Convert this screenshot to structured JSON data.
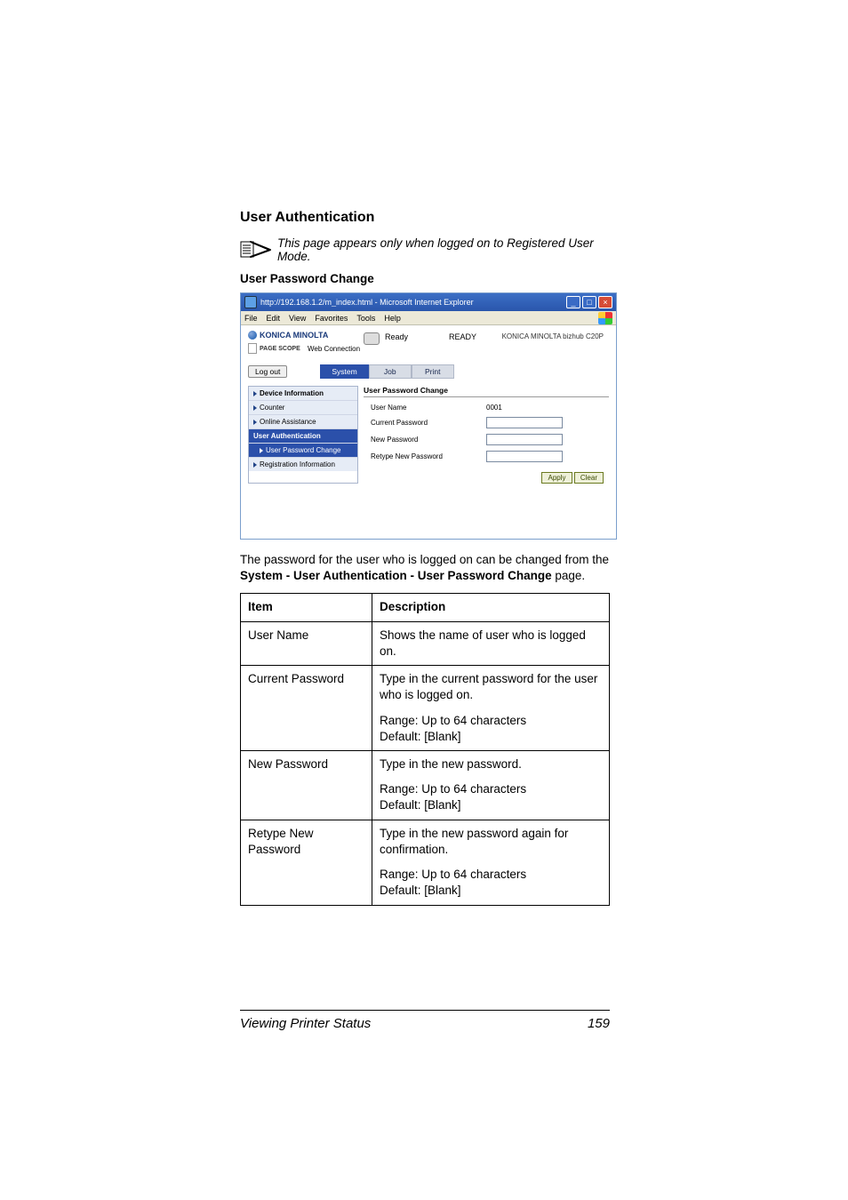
{
  "headings": {
    "h2": "User Authentication",
    "note": "This page appears only when logged on to Registered User Mode.",
    "h3": "User Password Change"
  },
  "screenshot": {
    "title": "http://192.168.1.2/m_index.html - Microsoft Internet Explorer",
    "menu": {
      "file": "File",
      "edit": "Edit",
      "view": "View",
      "fav": "Favorites",
      "tools": "Tools",
      "help": "Help"
    },
    "brand": "KONICA MINOLTA",
    "subbrand1": "PAGE SCOPE",
    "subbrand2": "Web Connection",
    "ready_label": "Ready",
    "ready_status": "READY",
    "model": "KONICA MINOLTA bizhub C20P",
    "logout": "Log out",
    "tabs": {
      "system": "System",
      "job": "Job",
      "print": "Print"
    },
    "side": {
      "devinfo": "Device Information",
      "counter": "Counter",
      "online": "Online Assistance",
      "userauth": "User Authentication",
      "upc": "User Password Change",
      "reg": "Registration Information"
    },
    "main_title": "User Password Change",
    "labels": {
      "uname": "User Name",
      "uval": "0001",
      "cur": "Current Password",
      "newp": "New Password",
      "retype": "Retype New Password"
    },
    "buttons": {
      "apply": "Apply",
      "clear": "Clear"
    }
  },
  "para": {
    "p1a": "The password for the user who is logged on can be changed from the ",
    "p1b": "System - User Authentication - User Password Change",
    "p1c": " page."
  },
  "table": {
    "h_item": "Item",
    "h_desc": "Description",
    "r1_item": "User Name",
    "r1_desc": "Shows the name of user who is logged on.",
    "r2_item": "Current Password",
    "r2_d1": "Type in the current password for the user who is logged on.",
    "r2_d2": "Range:   Up to 64 characters",
    "r2_d3": "Default:  [Blank]",
    "r3_item": "New Password",
    "r3_d1": "Type in the new password.",
    "r3_d2": "Range:   Up to 64 characters",
    "r3_d3": "Default:  [Blank]",
    "r4_item": "Retype New Password",
    "r4_d1": "Type in the new password again for confirmation.",
    "r4_d2": "Range:   Up to 64 characters",
    "r4_d3": "Default:  [Blank]"
  },
  "footer": {
    "title": "Viewing Printer Status",
    "page": "159"
  }
}
